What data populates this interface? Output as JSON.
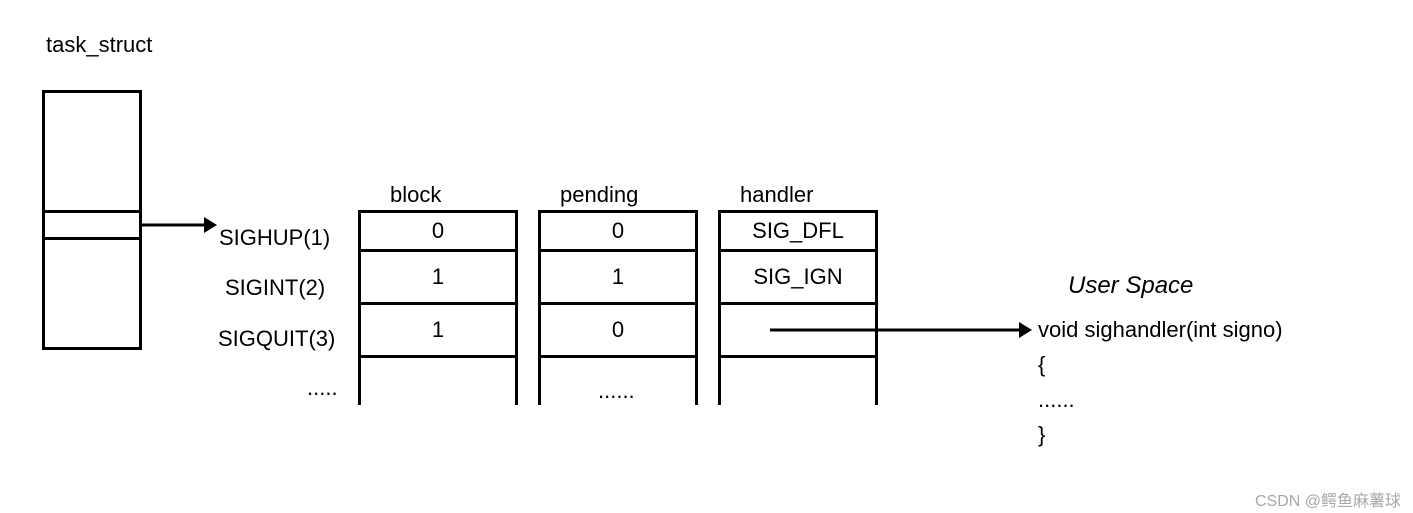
{
  "title": "task_struct",
  "labels": {
    "block": "block",
    "pending": "pending",
    "handler": "handler"
  },
  "signals": [
    "SIGHUP(1)",
    "SIGINT(2)",
    "SIGQUIT(3)"
  ],
  "ellipsis": ".....",
  "ellipsis2": "......",
  "columns": {
    "block": [
      "0",
      "1",
      "1"
    ],
    "pending": [
      "0",
      "1",
      "0"
    ],
    "handler": [
      "SIG_DFL",
      "SIG_IGN",
      ""
    ]
  },
  "userspace": {
    "title": "User Space",
    "line1": "void sighandler(int signo)",
    "line2": "{",
    "line3": "......",
    "line4": "}"
  },
  "watermark": "CSDN @鳄鱼麻薯球"
}
